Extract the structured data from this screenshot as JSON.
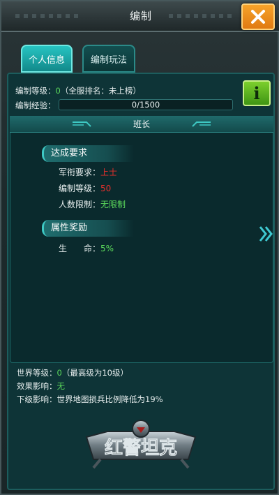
{
  "header": {
    "title": "编制",
    "close_label": "✕"
  },
  "tabs": [
    {
      "label": "个人信息",
      "active": true
    },
    {
      "label": "编制玩法",
      "active": false
    }
  ],
  "profile": {
    "level_label": "编制等级：",
    "level_value": "0",
    "rank_text": "（全服排名：未上榜）",
    "exp_label": "编制经验：",
    "exp_value": "0/1500",
    "exp_progress": 0
  },
  "info_button": {
    "label": "i"
  },
  "rank": {
    "title": "班长",
    "requirements": {
      "heading": "达成要求",
      "items": [
        {
          "label": "军衔要求：",
          "value": "上士"
        },
        {
          "label": "编制等级：",
          "value": "50"
        },
        {
          "label": "人数限制：",
          "value": "无限制"
        }
      ]
    },
    "rewards": {
      "heading": "属性奖励",
      "items": [
        {
          "label": "生　　命：",
          "value": "5%"
        }
      ]
    }
  },
  "footer": {
    "world_label": "世界等级：",
    "world_value": "0",
    "world_note": "（最高级为10级）",
    "effect_label": "效果影响：",
    "effect_value": "无",
    "sub_label": "下级影响：",
    "sub_value": "世界地图损兵比例降低为19%"
  },
  "logo": {
    "text": "红警坦克"
  },
  "colors": {
    "accent": "#27c4c2",
    "highlight_green": "#5bd85b",
    "highlight_red": "#e5302c",
    "close": "#f19420"
  }
}
